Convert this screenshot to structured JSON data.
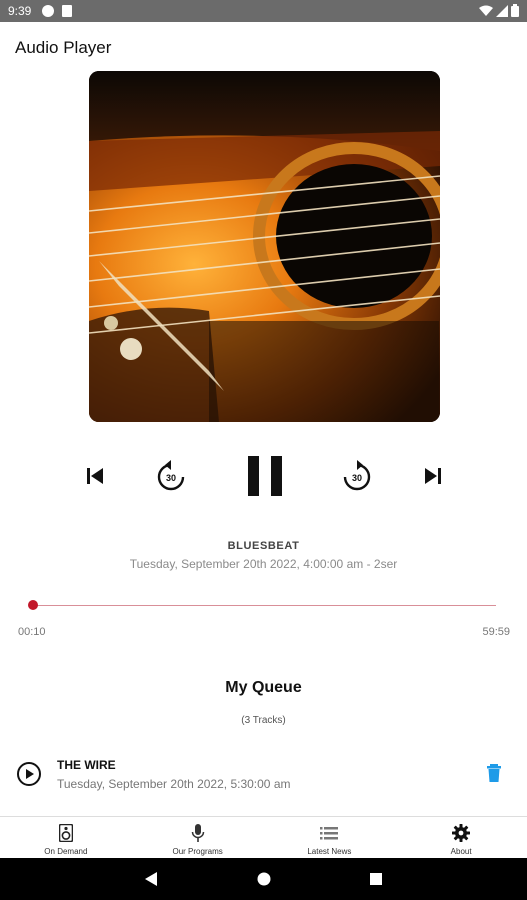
{
  "status_bar": {
    "time": "9:39"
  },
  "app_bar": {
    "title": "Audio Player"
  },
  "player": {
    "program_title": "BLUESBEAT",
    "program_date": "Tuesday, September 20th 2022, 4:00:00 am - 2ser",
    "progress_fraction": 0.003,
    "elapsed": "00:10",
    "total": "59:59",
    "rewind_seconds": "30",
    "forward_seconds": "30"
  },
  "queue": {
    "heading": "My Queue",
    "count": "(3 Tracks)",
    "items": [
      {
        "title": "THE WIRE",
        "date": "Tuesday, September 20th 2022, 5:30:00 am"
      }
    ]
  },
  "bottom_nav": {
    "items": [
      {
        "label": "On Demand",
        "icon": "speaker-icon"
      },
      {
        "label": "Our Programs",
        "icon": "microphone-icon"
      },
      {
        "label": "Latest News",
        "icon": "list-icon"
      },
      {
        "label": "About",
        "icon": "gear-icon"
      }
    ]
  },
  "colors": {
    "accent": "#c2172a",
    "delete": "#1e9be8",
    "status_bar": "#6b6b6b"
  }
}
